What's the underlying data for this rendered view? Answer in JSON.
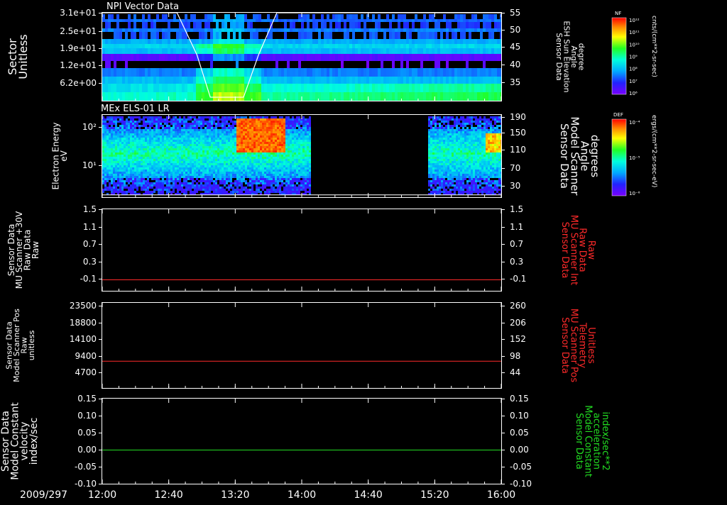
{
  "date_label": "2009/297",
  "time_ticks": [
    "12:00",
    "12:40",
    "13:20",
    "14:00",
    "14:40",
    "15:20",
    "16:00"
  ],
  "colors": {
    "background": "#000000",
    "frame": "#ffffff",
    "red_line": "#ff2a2a",
    "green_line": "#22dd22"
  },
  "panels": [
    {
      "id": "npi",
      "title": "NPI Vector Data",
      "left_label": [
        "Sector",
        "Unitless"
      ],
      "left_ticks": [
        "3.1e+01",
        "2.5e+01",
        "1.9e+01",
        "1.2e+01",
        "6.2e+00"
      ],
      "right_ticks": [
        "55",
        "50",
        "45",
        "40",
        "35"
      ],
      "right_label": [
        "Sensor Data",
        "ESH Sun Elevation",
        "Angle",
        "degree"
      ],
      "colorbar": {
        "label": "NF",
        "units": "cnts/(cm**2-sr-sec)",
        "ticks": [
          "10¹²",
          "10¹¹",
          "10¹⁰",
          "10⁹",
          "10⁸",
          "10⁷",
          "10⁶"
        ]
      }
    },
    {
      "id": "els",
      "title": "MEx ELS-01 LR",
      "left_label": [
        "Electron Energy",
        "eV"
      ],
      "left_ticks": [
        "10²",
        "10¹"
      ],
      "right_ticks": [
        "190",
        "150",
        "110",
        "70",
        "30"
      ],
      "right_label": [
        "Sensor Data",
        "Model Scanner",
        "Angle",
        "degrees"
      ],
      "colorbar": {
        "label": "DEF",
        "units": "ergs/(cm**2-sr-sec-eV)",
        "ticks": [
          "10⁻⁴",
          "10⁻⁵",
          "10⁻⁶"
        ]
      }
    },
    {
      "id": "raw",
      "left_label": [
        "Sensor Data",
        "MU Scanner +30V",
        "Raw Data",
        "Raw"
      ],
      "left_ticks": [
        "1.5",
        "1.1",
        "0.7",
        "0.3",
        "-0.1"
      ],
      "right_ticks": [
        "1.5",
        "1.1",
        "0.7",
        "0.3",
        "-0.1"
      ],
      "right_label": [
        "Sensor Data",
        "MU Scanner Int",
        "Raw Data",
        "Raw"
      ]
    },
    {
      "id": "pos",
      "left_label": [
        "Sensor Data",
        "Model Scanner Pos",
        "Raw",
        "unitless"
      ],
      "left_ticks": [
        "23500",
        "18800",
        "14100",
        "9400",
        "4700"
      ],
      "right_ticks": [
        "260",
        "206",
        "152",
        "98",
        "44"
      ],
      "right_label": [
        "Sensor Data",
        "MU Scanner Pos",
        "Telemetry",
        "Unitless"
      ]
    },
    {
      "id": "vel",
      "left_label": [
        "Sensor Data",
        "Model Constant",
        "velocity",
        "index/sec"
      ],
      "left_ticks": [
        "0.15",
        "0.10",
        "0.05",
        "0.00",
        "-0.05",
        "-0.10"
      ],
      "right_ticks": [
        "0.15",
        "0.10",
        "0.05",
        "0.00",
        "-0.05",
        "-0.10"
      ],
      "right_label": [
        "Sensor Data",
        "Model Constant",
        "acceleration",
        "index/sec**2"
      ]
    }
  ],
  "chart_data": [
    {
      "type": "heatmap",
      "title": "NPI Vector Data",
      "xlabel": "",
      "ylabel": "Sector Unitless",
      "x_range": [
        "12:00",
        "16:00"
      ],
      "ylim": [
        0,
        31
      ],
      "overlay_line": {
        "name": "ESH Sun Elevation Angle (degree)",
        "axis_range": [
          31,
          56
        ],
        "points": [
          [
            "12:00",
            56
          ],
          [
            "12:45",
            56
          ],
          [
            "12:57",
            44
          ],
          [
            "13:05",
            32
          ],
          [
            "13:25",
            32
          ],
          [
            "13:34",
            44
          ],
          [
            "13:45",
            56
          ],
          [
            "16:00",
            56
          ]
        ]
      }
    },
    {
      "type": "heatmap",
      "title": "MEx ELS-01 LR",
      "ylabel": "Electron Energy eV",
      "y_scale": "log",
      "x_range": [
        "12:00",
        "16:00"
      ],
      "data_gap": [
        "14:05",
        "15:15"
      ],
      "overlay_line": {
        "name": "Model Scanner Angle (degrees)",
        "axis_range": [
          0,
          190
        ],
        "points": [
          [
            "12:00",
            2
          ],
          [
            "16:00",
            2
          ]
        ]
      }
    },
    {
      "type": "line",
      "ylabel": "MU Scanner +30V Raw Data Raw",
      "ylim": [
        -0.3,
        1.5
      ],
      "series": [
        {
          "name": "MU Scanner Int Raw Data",
          "x": [
            "12:00",
            "16:00"
          ],
          "values": [
            -0.05,
            -0.05
          ],
          "color": "#ff2a2a"
        }
      ]
    },
    {
      "type": "line",
      "ylabel": "Model Scanner Pos Raw unitless",
      "ylim": [
        0,
        23500
      ],
      "y2lim": [
        0,
        260
      ],
      "series": [
        {
          "name": "MU Scanner Pos Telemetry",
          "x": [
            "12:00",
            "16:00"
          ],
          "values": [
            7500,
            7500
          ],
          "color": "#ff2a2a"
        }
      ]
    },
    {
      "type": "line",
      "ylabel": "Model Constant velocity index/sec",
      "ylim": [
        -0.1,
        0.15
      ],
      "series": [
        {
          "name": "Model Constant acceleration",
          "x": [
            "12:00",
            "16:00"
          ],
          "values": [
            0.0,
            0.0
          ],
          "color": "#22dd22"
        }
      ]
    }
  ]
}
